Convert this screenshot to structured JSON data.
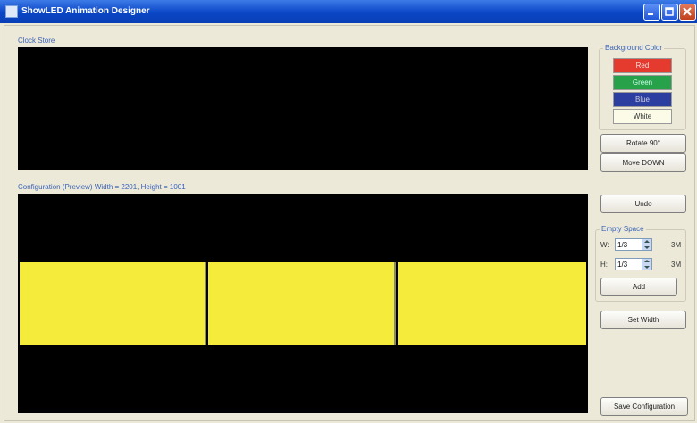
{
  "window": {
    "title": "ShowLED Animation Designer"
  },
  "clock_store": {
    "label": "Clock Store"
  },
  "background_color": {
    "legend": "Background Color",
    "colors": [
      {
        "name": "Red",
        "hex": "#e53a2e"
      },
      {
        "name": "Green",
        "hex": "#28a24a"
      },
      {
        "name": "Blue",
        "hex": "#2c3fa0"
      },
      {
        "name": "White",
        "hex": "#fbfbe8"
      }
    ]
  },
  "buttons": {
    "rotate": "Rotate 90°",
    "move_down": "Move DOWN",
    "undo": "Undo",
    "add": "Add",
    "set_width": "Set Width",
    "save_configuration": "Save Configuration"
  },
  "configuration": {
    "label": "Configuration (Preview) Width = 2201, Height = 1001"
  },
  "empty_space": {
    "legend": "Empty Space",
    "w_label": "W:",
    "w_value": "1/3",
    "w_unit": "3M",
    "h_label": "H:",
    "h_value": "1/3",
    "h_unit": "3M"
  },
  "preview": {
    "panel_color": "#f5eb3b",
    "panel_count": 3
  }
}
